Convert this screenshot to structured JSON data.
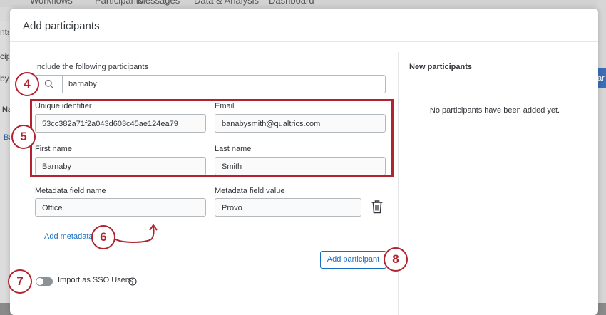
{
  "background": {
    "nav_items": [
      "Workflows",
      "Participants",
      "Messages",
      "Data & Analysis",
      "Dashboard"
    ],
    "left_fragments": [
      "nts",
      "cipa",
      "by n",
      "Na",
      "Ba"
    ],
    "right_button_fragment": "ar"
  },
  "modal": {
    "title": "Add participants",
    "include_label": "Include the following participants",
    "search": {
      "value": "barnaby",
      "icon": "search-icon"
    },
    "fields": {
      "unique_identifier": {
        "label": "Unique identifier",
        "value": "53cc382a71f2a043d603c45ae124ea79"
      },
      "email": {
        "label": "Email",
        "value": "banabysmith@qualtrics.com"
      },
      "first_name": {
        "label": "First name",
        "value": "Barnaby"
      },
      "last_name": {
        "label": "Last name",
        "value": "Smith"
      },
      "metadata_name": {
        "label": "Metadata field name",
        "value": "Office"
      },
      "metadata_value": {
        "label": "Metadata field value",
        "value": "Provo"
      }
    },
    "add_metadata_label": "Add metadata",
    "add_participant_label": "Add participant",
    "sso_label": "Import as SSO Users",
    "sso_enabled": false,
    "right_panel": {
      "title": "New participants",
      "empty_message": "No participants have been added yet."
    }
  },
  "callouts": [
    "4",
    "5",
    "6",
    "7",
    "8"
  ],
  "colors": {
    "accent": "#1a6ec1",
    "callout": "#b3232f"
  }
}
